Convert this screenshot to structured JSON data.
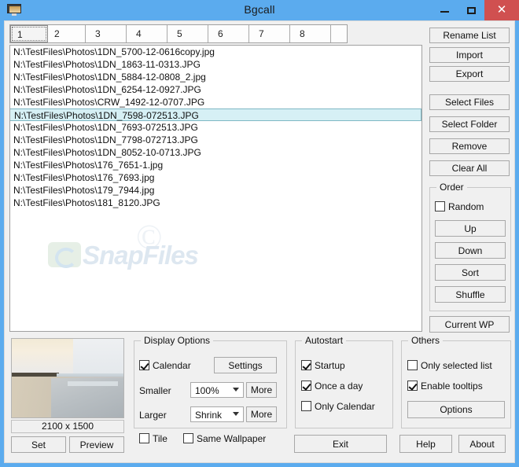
{
  "window": {
    "title": "Bgcall",
    "icon": "monitor-icon",
    "controls": {
      "minimize": "–",
      "maximize": "□",
      "close": "✕"
    },
    "accent_color": "#5babee",
    "close_color": "#d05050"
  },
  "tabs": [
    {
      "label": "1",
      "selected": true
    },
    {
      "label": "2",
      "selected": false
    },
    {
      "label": "3",
      "selected": false
    },
    {
      "label": "4",
      "selected": false
    },
    {
      "label": "5",
      "selected": false
    },
    {
      "label": "6",
      "selected": false
    },
    {
      "label": "7",
      "selected": false
    },
    {
      "label": "8",
      "selected": false
    }
  ],
  "file_list": {
    "selected_index": 5,
    "selection_color": "#d6f0f5",
    "items": [
      "N:\\TestFiles\\Photos\\1DN_5700-12-0616copy.jpg",
      "N:\\TestFiles\\Photos\\1DN_1863-11-0313.JPG",
      "N:\\TestFiles\\Photos\\1DN_5884-12-0808_2.jpg",
      "N:\\TestFiles\\Photos\\1DN_6254-12-0927.JPG",
      "N:\\TestFiles\\Photos\\CRW_1492-12-0707.JPG",
      "N:\\TestFiles\\Photos\\1DN_7598-072513.JPG",
      "N:\\TestFiles\\Photos\\1DN_7693-072513.JPG",
      "N:\\TestFiles\\Photos\\1DN_7798-072713.JPG",
      "N:\\TestFiles\\Photos\\1DN_8052-10-0713.JPG",
      "N:\\TestFiles\\Photos\\176_7651-1.jpg",
      "N:\\TestFiles\\Photos\\176_7693.jpg",
      "N:\\TestFiles\\Photos\\179_7944.jpg",
      "N:\\TestFiles\\Photos\\181_8120.JPG"
    ]
  },
  "watermark": {
    "copyright": "©",
    "text": "SnapFiles"
  },
  "side_buttons": {
    "rename_list": "Rename List",
    "import": "Import",
    "export": "Export",
    "select_files": "Select Files",
    "select_folder": "Select Folder",
    "remove": "Remove",
    "clear_all": "Clear All",
    "current_wp": "Current WP"
  },
  "order_group": {
    "title": "Order",
    "random": {
      "label": "Random",
      "checked": false
    },
    "up": "Up",
    "down": "Down",
    "sort": "Sort",
    "shuffle": "Shuffle"
  },
  "preview": {
    "dimensions": "2100 x 1500",
    "set_button": "Set",
    "preview_button": "Preview",
    "image_alt": "beach-sunset-thumbnail"
  },
  "display_options": {
    "title": "Display Options",
    "calendar": {
      "label": "Calendar",
      "checked": true
    },
    "settings_button": "Settings",
    "smaller_label": "Smaller",
    "smaller_value": "100%",
    "smaller_more": "More",
    "larger_label": "Larger",
    "larger_value": "Shrink",
    "larger_more": "More",
    "tile": {
      "label": "Tile",
      "checked": false
    },
    "same_wallpaper": {
      "label": "Same Wallpaper",
      "checked": false
    }
  },
  "autostart": {
    "title": "Autostart",
    "startup": {
      "label": "Startup",
      "checked": true
    },
    "once_a_day": {
      "label": "Once a day",
      "checked": true
    },
    "only_calendar": {
      "label": "Only Calendar",
      "checked": false
    }
  },
  "others": {
    "title": "Others",
    "only_selected_list": {
      "label": "Only selected list",
      "checked": false
    },
    "enable_tooltips": {
      "label": "Enable tooltips",
      "checked": true
    },
    "options_button": "Options"
  },
  "bottom_buttons": {
    "exit": "Exit",
    "help": "Help",
    "about": "About"
  }
}
